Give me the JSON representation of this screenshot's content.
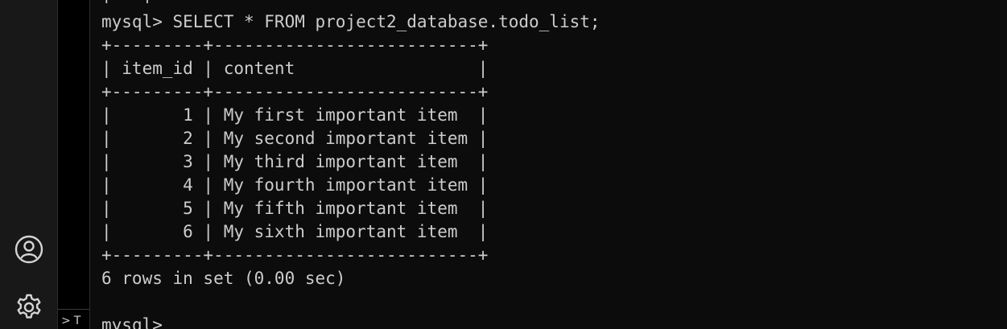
{
  "terminal": {
    "lines": [
      "+---+",
      "mysql> SELECT * FROM project2_database.todo_list;",
      "+---------+--------------------------+",
      "| item_id | content                  |",
      "+---------+--------------------------+",
      "|       1 | My first important item  |",
      "|       2 | My second important item |",
      "|       3 | My third important item  |",
      "|       4 | My fourth important item |",
      "|       5 | My fifth important item  |",
      "|       6 | My sixth important item  |",
      "+---------+--------------------------+",
      "6 rows in set (0.00 sec)",
      "",
      "mysql> "
    ]
  },
  "side_panel": {
    "chevron": ">",
    "label": "T"
  },
  "icons": {
    "account": "account-icon",
    "settings": "gear-icon"
  },
  "colors": {
    "terminal_bg": "#0c0c0c",
    "terminal_fg": "#cccccc",
    "activity_bar_bg": "#181818"
  }
}
